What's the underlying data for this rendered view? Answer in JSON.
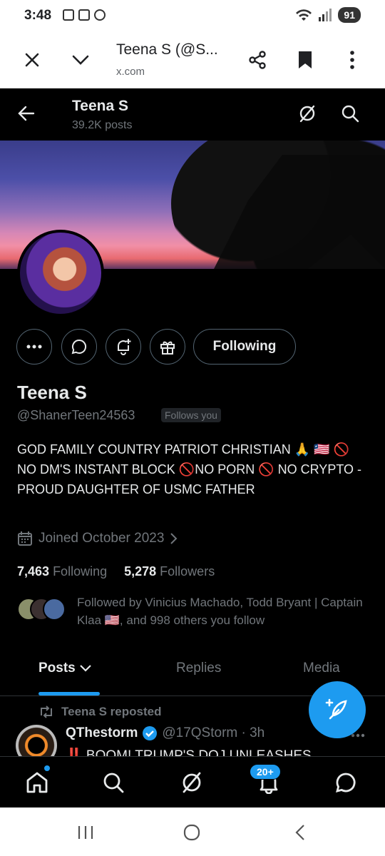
{
  "status_bar": {
    "time": "3:48",
    "battery": "91"
  },
  "custom_tab": {
    "title": "Teena S (@S...",
    "url": "x.com"
  },
  "header": {
    "name": "Teena S",
    "post_count": "39.2K posts"
  },
  "profile": {
    "following_button": "Following",
    "display_name": "Teena S",
    "handle": "@ShanerTeen24563",
    "follows_you": "Follows you",
    "bio": "GOD FAMILY COUNTRY PATRIOT CHRISTIAN 🙏 🇱🇷 🚫NO DM'S INSTANT BLOCK 🚫NO PORN 🚫 NO CRYPTO - PROUD DAUGHTER OF USMC FATHER",
    "joined": "Joined October 2023",
    "following_count": "7,463",
    "following_label": "Following",
    "followers_count": "5,278",
    "followers_label": "Followers",
    "followed_by": "Followed by Vinicius Machado, Todd Bryant | Captain Klaa 🇺🇸, and 998 others you follow"
  },
  "tabs": [
    {
      "label": "Posts"
    },
    {
      "label": "Replies"
    },
    {
      "label": "Media"
    }
  ],
  "post": {
    "repost_label": "Teena S reposted",
    "author": "QThestorm",
    "handle_time": "@17QStorm · 3h",
    "text": "‼️ BOOM! TRUMP'S DOJ UNLEASHES"
  },
  "bottom_nav": {
    "notifications_badge": "20+"
  },
  "colors": {
    "accent": "#1d9bf0",
    "background": "#000000",
    "muted": "#71767b"
  }
}
